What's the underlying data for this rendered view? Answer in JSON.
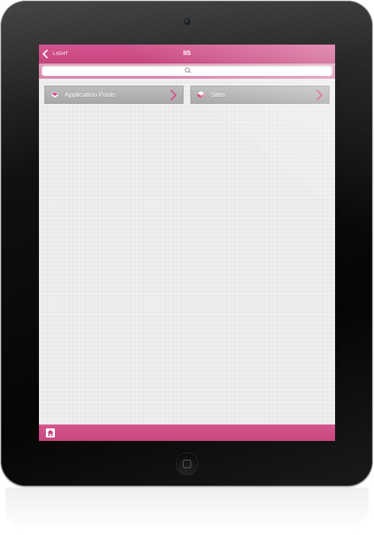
{
  "app": {
    "title": "IIS",
    "back_label": "LIGHT"
  },
  "search": {
    "placeholder": ""
  },
  "tiles": [
    {
      "label": "Application Pools",
      "icon": "application-pools-icon"
    },
    {
      "label": "Sites",
      "icon": "sites-icon"
    }
  ],
  "toolbar": {
    "home_icon": "home-icon"
  },
  "colors": {
    "accent": "#d2558f",
    "tile": "#b3b3b3",
    "arrow": "#d84b8c"
  }
}
